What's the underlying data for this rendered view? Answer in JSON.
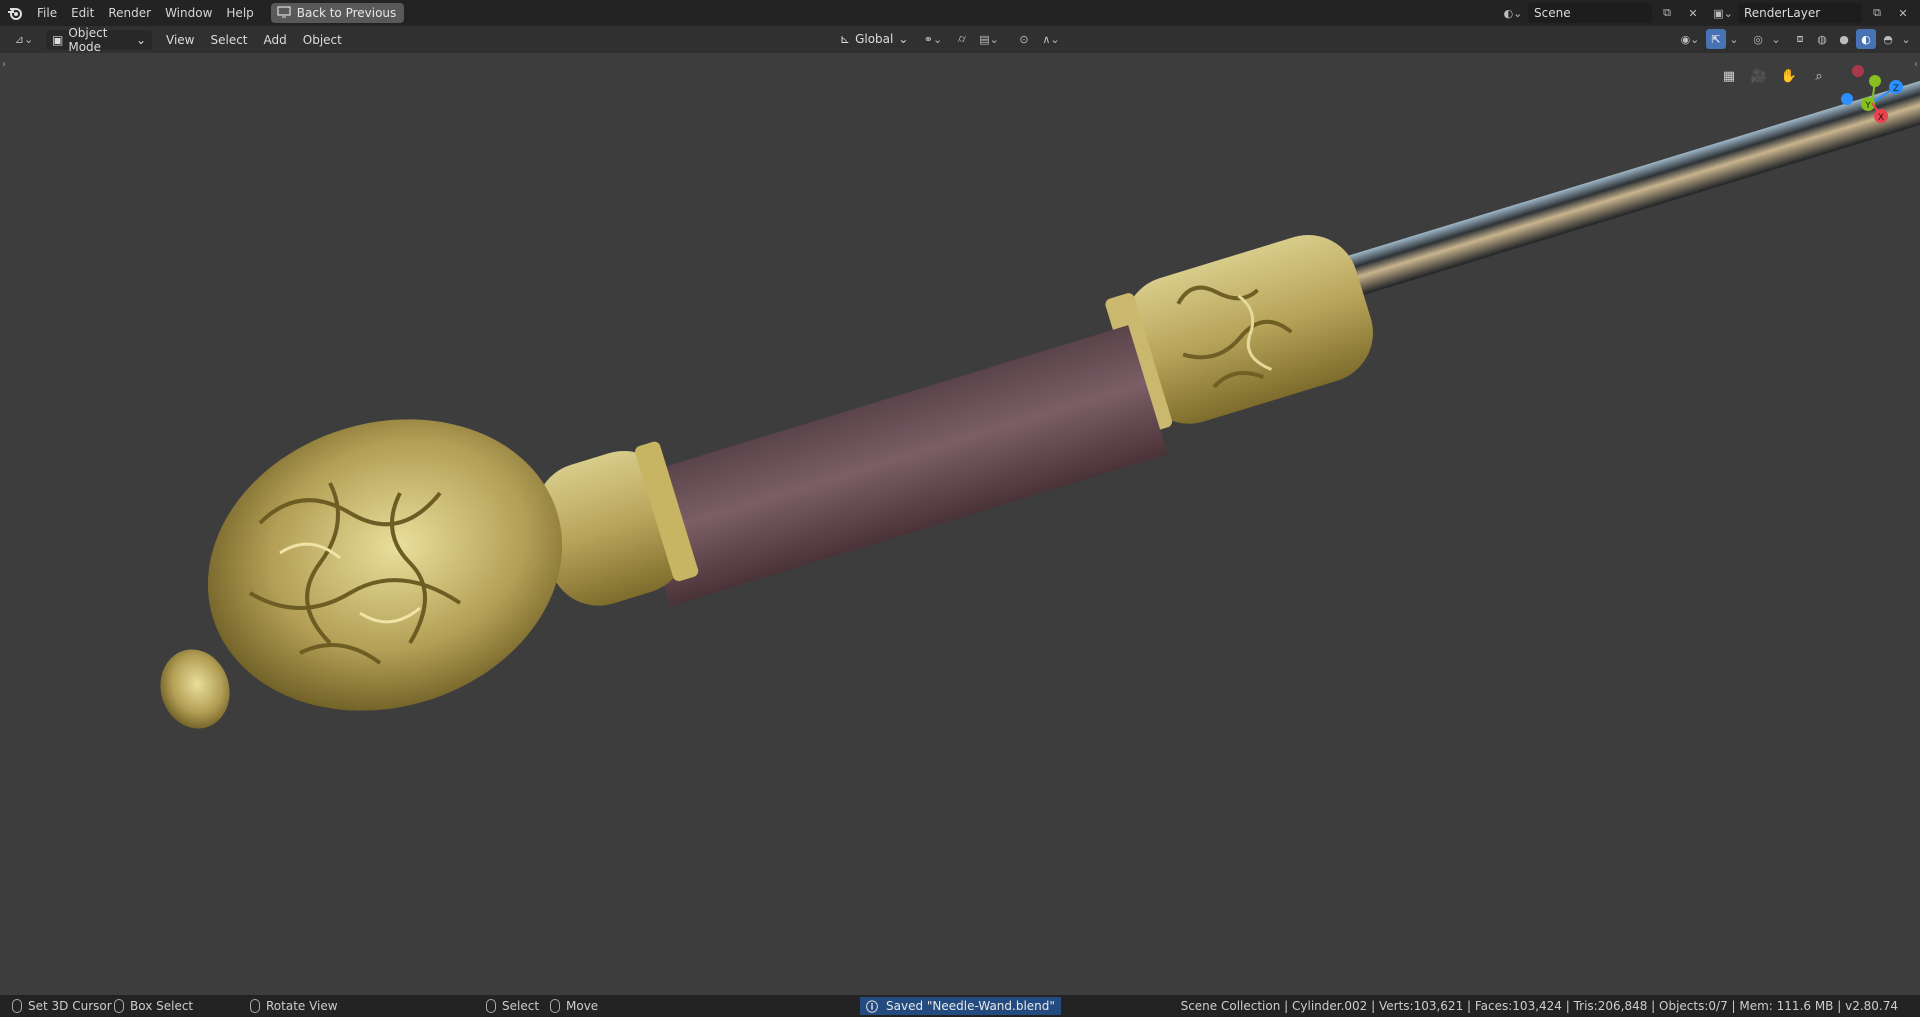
{
  "topbar": {
    "menus": [
      "File",
      "Edit",
      "Render",
      "Window",
      "Help"
    ],
    "back_label": "Back to Previous",
    "scene_value": "Scene",
    "layer_value": "RenderLayer"
  },
  "header": {
    "mode": "Object Mode",
    "menus": [
      "View",
      "Select",
      "Add",
      "Object"
    ],
    "transform_orientation": "Global"
  },
  "viewport": {
    "gizmo_axes": [
      "Z",
      "Y",
      "X"
    ],
    "colors": {
      "background": "#3d3d3d",
      "gold": "#b8a45a",
      "handle": "#6e4e56",
      "axis_x": "#e8434f",
      "axis_y": "#87c01e",
      "axis_z": "#2c8fff"
    }
  },
  "status": {
    "left": [
      {
        "icon": "mouse-left-icon",
        "label": "Set 3D Cursor"
      },
      {
        "icon": "mouse-right-icon",
        "label": "Box Select"
      },
      {
        "icon": "mouse-middle-icon",
        "label": "Rotate View"
      },
      {
        "icon": "mouse-left-icon",
        "label": "Select"
      },
      {
        "icon": "mouse-right-icon",
        "label": "Move"
      }
    ],
    "message": "Saved \"Needle-Wand.blend\"",
    "stats": "Scene Collection | Cylinder.002 | Verts:103,621 | Faces:103,424 | Tris:206,848 | Objects:0/7 | Mem: 111.6 MB | v2.80.74"
  }
}
